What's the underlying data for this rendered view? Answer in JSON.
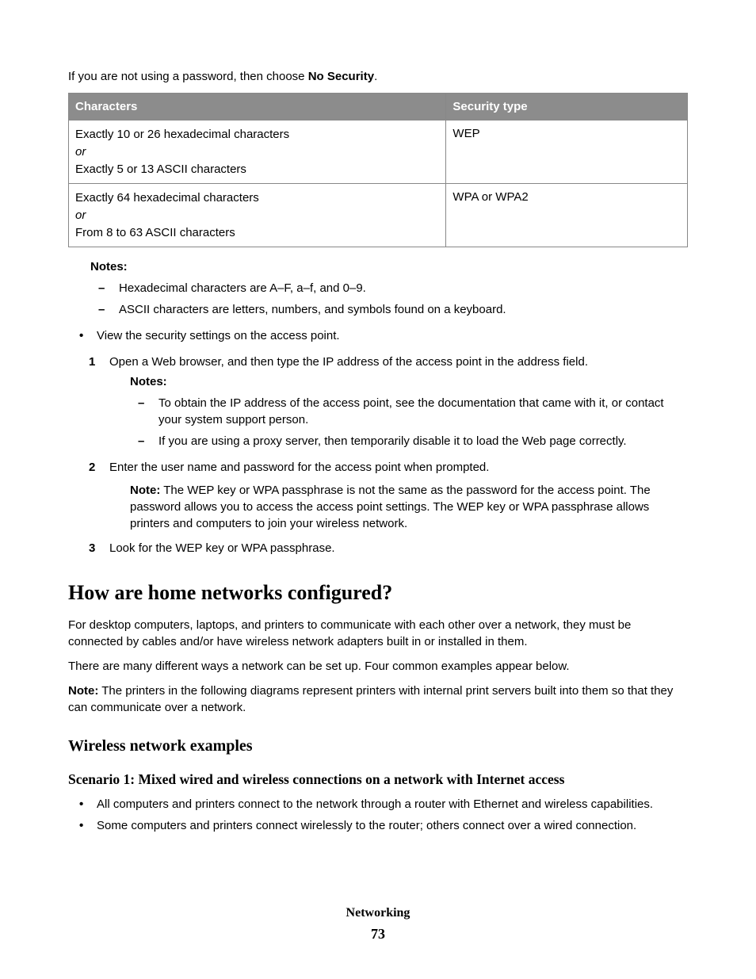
{
  "intro": {
    "prefix": "If you are not using a password, then choose ",
    "bold": "No Security",
    "suffix": "."
  },
  "table": {
    "headers": {
      "col1": "Characters",
      "col2": "Security type"
    },
    "rows": [
      {
        "chars": {
          "line1": "Exactly 10 or 26 hexadecimal characters",
          "or": "or",
          "line2": "Exactly 5 or 13 ASCII characters"
        },
        "type": "WEP"
      },
      {
        "chars": {
          "line1": "Exactly 64 hexadecimal characters",
          "or": "or",
          "line2": "From 8 to 63 ASCII characters"
        },
        "type": "WPA or WPA2"
      }
    ]
  },
  "notes_label": "Notes:",
  "notes1": {
    "items": [
      "Hexadecimal characters are A–F, a–f, and 0–9.",
      "ASCII characters are letters, numbers, and symbols found on a keyboard."
    ]
  },
  "bullet_item": "View the security settings on the access point.",
  "steps": {
    "s1": {
      "text": "Open a Web browser, and then type the IP address of the access point in the address field.",
      "notes": [
        "To obtain the IP address of the access point, see the documentation that came with it, or contact your system support person.",
        "If you are using a proxy server, then temporarily disable it to load the Web page correctly."
      ]
    },
    "s2": {
      "text": "Enter the user name and password for the access point when prompted.",
      "note_label": "Note:",
      "note_body": " The WEP key or WPA passphrase is not the same as the password for the access point. The password allows you to access the access point settings. The WEP key or WPA passphrase allows printers and computers to join your wireless network."
    },
    "s3": {
      "text": "Look for the WEP key or WPA passphrase."
    }
  },
  "heading2": "How are home networks configured?",
  "para1": "For desktop computers, laptops, and printers to communicate with each other over a network, they must be connected by cables and/or have wireless network adapters built in or installed in them.",
  "para2": "There are many different ways a network can be set up. Four common examples appear below.",
  "para3_label": "Note:",
  "para3_body": " The printers in the following diagrams represent printers with internal print servers built into them so that they can communicate over a network.",
  "heading3": "Wireless network examples",
  "heading4": "Scenario 1: Mixed wired and wireless connections on a network with Internet access",
  "scen_bullets": [
    "All computers and printers connect to the network through a router with Ethernet and wireless capabilities.",
    "Some computers and printers connect wirelessly to the router; others connect over a wired connection."
  ],
  "footer": {
    "section": "Networking",
    "page": "73"
  }
}
